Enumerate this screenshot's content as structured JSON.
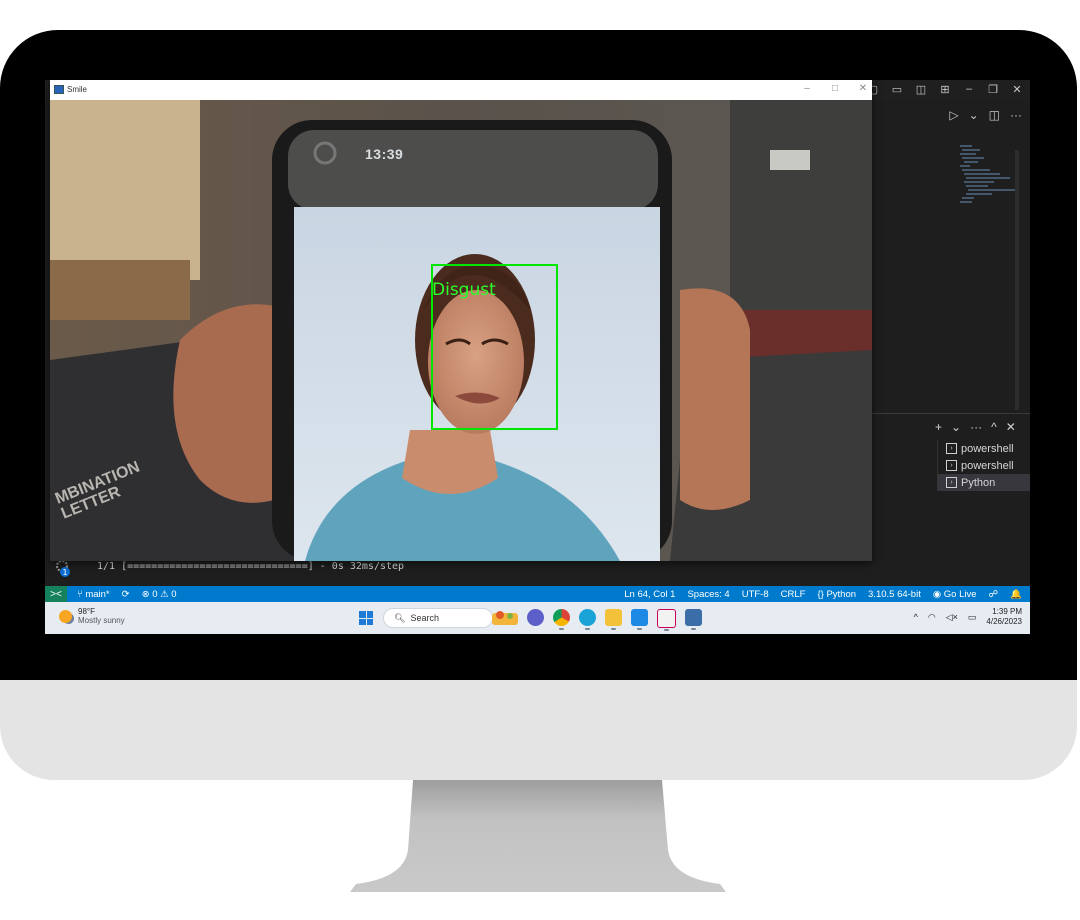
{
  "webcam_window": {
    "title": "Smile",
    "controls": [
      "–",
      "□",
      "✕"
    ],
    "detection": {
      "label": "Disgust",
      "box_color": "#00e600"
    },
    "phone_status_time": "13:39",
    "shirt_text": [
      "MBINATION",
      "LETTER"
    ]
  },
  "vscode": {
    "title_icons": [
      "▢",
      "▭",
      "◫",
      "⊞",
      "–",
      "❐",
      "✕"
    ],
    "toolbar": {
      "run": "▷",
      "run_menu": "⌄",
      "split": "◫",
      "more": "···"
    },
    "panel_actions": [
      "+",
      "⌄",
      "···",
      "^",
      "✕"
    ],
    "terminals": [
      {
        "label": "powershell",
        "active": false
      },
      {
        "label": "powershell",
        "active": false
      },
      {
        "label": "Python",
        "active": true
      }
    ],
    "terminal_output": "1/1 [==============================] - 0s 32ms/step",
    "accounts_badge": "1",
    "statusbar": {
      "remote_icon": "><",
      "branch": "main*",
      "sync_icon": "⟳",
      "problems": "⊗ 0 ⚠ 0",
      "cursor": "Ln 64, Col 1",
      "spaces": "Spaces: 4",
      "encoding": "UTF-8",
      "eol": "CRLF",
      "language": "{} Python",
      "interpreter": "3.10.5 64-bit",
      "go_live": "Go Live",
      "feedback_icon": "☍",
      "bell_icon": "🔔"
    },
    "accent_color": "#007acc"
  },
  "taskbar": {
    "weather": {
      "temp": "98°F",
      "condition": "Mostly sunny"
    },
    "search_label": "Search",
    "tray": {
      "chevron": "^",
      "wifi": "◠",
      "volume": "◁×",
      "battery": "▭"
    },
    "clock": {
      "time": "1:39 PM",
      "date": "4/26/2023"
    }
  }
}
